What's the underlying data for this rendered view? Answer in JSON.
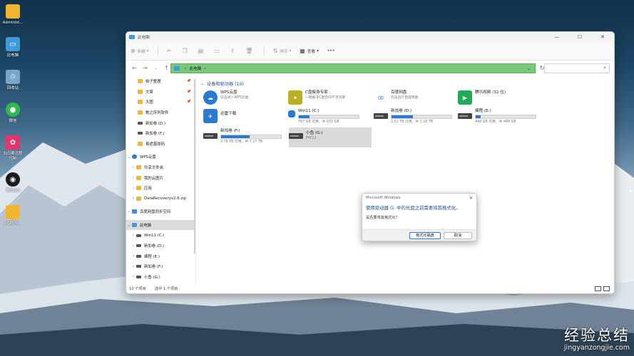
{
  "desktop": {
    "icons": [
      {
        "label": "Administ...",
        "icon": "folder-icon",
        "color": "#f2b530"
      },
      {
        "label": "此电脑",
        "icon": "computer-icon",
        "color": "#3f9ad8"
      },
      {
        "label": "回收站",
        "icon": "recycle-bin-icon",
        "color": "#7aa5c9"
      },
      {
        "label": "微信",
        "icon": "wechat-icon",
        "color": "#2dbb4e"
      },
      {
        "label": "向日葵远程\n控制",
        "icon": "sunflower-icon",
        "color": "#e8336b"
      },
      {
        "label": "腾讯QQ",
        "icon": "qq-icon",
        "color": "#1b1b1b"
      },
      {
        "label": "2020年...",
        "icon": "folder-icon",
        "color": "#f2b530"
      }
    ]
  },
  "window": {
    "title": "此电脑",
    "toolbar": {
      "new_label": "新建",
      "sort_label": "排序",
      "view_label": "查看",
      "more_label": "···"
    },
    "address": {
      "crumb": "此电脑",
      "search_placeholder": ""
    },
    "sidebar": {
      "quick_access": [
        {
          "label": "帖子整理",
          "pinned": true
        },
        {
          "label": "文章",
          "pinned": true
        },
        {
          "label": "大图",
          "pinned": true
        },
        {
          "label": "數之序列软件",
          "pinned": false
        },
        {
          "label": "新加卷 (D:)",
          "pinned": false
        },
        {
          "label": "新加卷 (F:)",
          "pinned": false
        },
        {
          "label": "易遮蓋原码",
          "pinned": false
        }
      ],
      "wps": {
        "label": "WPS云盘",
        "children": [
          "共享文件夹",
          "我的云图片",
          "应用",
          "DataRecoveryv2.6.zip"
        ]
      },
      "baidu": "百度网盘同步空间",
      "this_pc": {
        "label": "此电脑",
        "children": [
          "Win11 (C:)",
          "新加卷 (D:)",
          "编程 (E:)",
          "新加卷 (F:)",
          "小鱼 (G:)"
        ]
      }
    },
    "section_title": "设备和驱动器 (10)",
    "apps": [
      {
        "name": "WPS云盘",
        "sub": "双击进入WPS云盘",
        "color": "#2a7ad4"
      },
      {
        "name": "C盘瘦身专家",
        "sub": "一键解决C盘空间不足问题",
        "color": "#b8b020"
      },
      {
        "name": "百度网盘",
        "sub": "双击运行百度网盘",
        "color": "#3a8ee6"
      },
      {
        "name": "腾讯视频 (32 位)",
        "sub": "",
        "color": "#22aa55"
      },
      {
        "name": "迅雷下载",
        "sub": "",
        "color": "#2a7ad4"
      }
    ],
    "drives": [
      {
        "name": "Win11 (C:)",
        "sub": "767 GB 可用，共 931 GB",
        "used": 0.18
      },
      {
        "name": "新加卷 (D:)",
        "sub": "2.01 TB 可用，共 3.16 TB",
        "used": 0.36
      },
      {
        "name": "编程 (E:)",
        "sub": "448 GB 可用，共 488 GB",
        "used": 0.08
      },
      {
        "name": "新加卷 (F:)",
        "sub": "3.78 TB 可用，共 7.27 TB",
        "used": 0.48
      },
      {
        "name": "小鱼 (G:)",
        "sub": "FAT32",
        "used": null
      }
    ],
    "status": {
      "items": "10 个项目",
      "selected": "选中 1 个项目"
    }
  },
  "dialog": {
    "title": "Microsoft Windows",
    "heading": "使用驱动器 G: 中的光盘之前需要将其格式化。",
    "question": "是否要将其格式化?",
    "primary_button": "格式化磁盘",
    "cancel_button": "取消"
  },
  "watermark": {
    "cn": "经验总结",
    "en": "jingyanzongjie.com"
  }
}
